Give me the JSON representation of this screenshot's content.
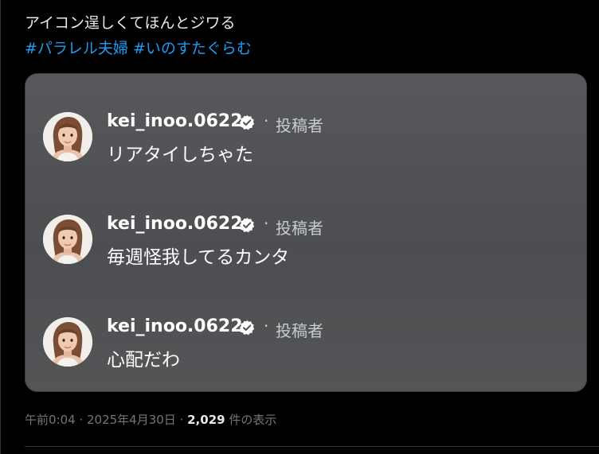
{
  "tweet": {
    "text": "アイコン逞しくてほんとジワる",
    "hashtags": [
      "#パラレル夫婦",
      "#いのすたぐらむ"
    ]
  },
  "comments": [
    {
      "username": "kei_inoo.0622",
      "separator": "·",
      "role": "投稿者",
      "text": "リアタイしちゃた",
      "verified_icon": "verified-badge-icon"
    },
    {
      "username": "kei_inoo.0622",
      "separator": "·",
      "role": "投稿者",
      "text": "毎週怪我してるカンタ",
      "verified_icon": "verified-badge-icon"
    },
    {
      "username": "kei_inoo.0622",
      "separator": "·",
      "role": "投稿者",
      "text": "心配だわ",
      "verified_icon": "verified-badge-icon"
    }
  ],
  "meta": {
    "time": "午前0:04",
    "sep1": " · ",
    "date": "2025年4月30日",
    "sep2": " · ",
    "views_count": "2,029",
    "views_label": " 件の表示"
  },
  "colors": {
    "background": "#000000",
    "text": "#e7e9ea",
    "hashtag": "#1d9bf0",
    "muted": "#71767b",
    "card": "#535558"
  }
}
